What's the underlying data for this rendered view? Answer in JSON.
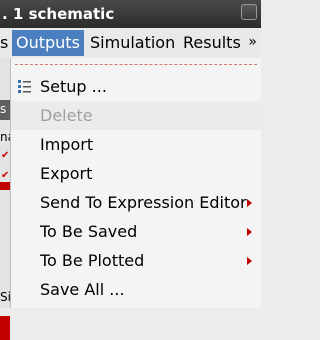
{
  "window": {
    "title": ". 1 schematic"
  },
  "menubar": {
    "items": [
      {
        "label": "s"
      },
      {
        "label": "Outputs"
      },
      {
        "label": "Simulation"
      },
      {
        "label": "Results"
      }
    ],
    "overflow": "»"
  },
  "left_panel": {
    "glyph_top": "s",
    "glyph_mid": "na",
    "glyph_bottom": "Si"
  },
  "outputs_menu": {
    "items": [
      {
        "label": "Setup ...",
        "icon": "setup-list-icon"
      },
      {
        "label": "Delete",
        "disabled": true
      },
      {
        "label": "Import"
      },
      {
        "label": "Export"
      },
      {
        "label": "Send To Expression Editor",
        "submenu": true
      },
      {
        "label": "To Be Saved",
        "submenu": true
      },
      {
        "label": "To Be Plotted",
        "submenu": true
      },
      {
        "label": "Save All ..."
      }
    ]
  },
  "colors": {
    "highlight": "#4b7fc0",
    "accent": "#c40000",
    "disabled_text": "#a0a0a0"
  }
}
